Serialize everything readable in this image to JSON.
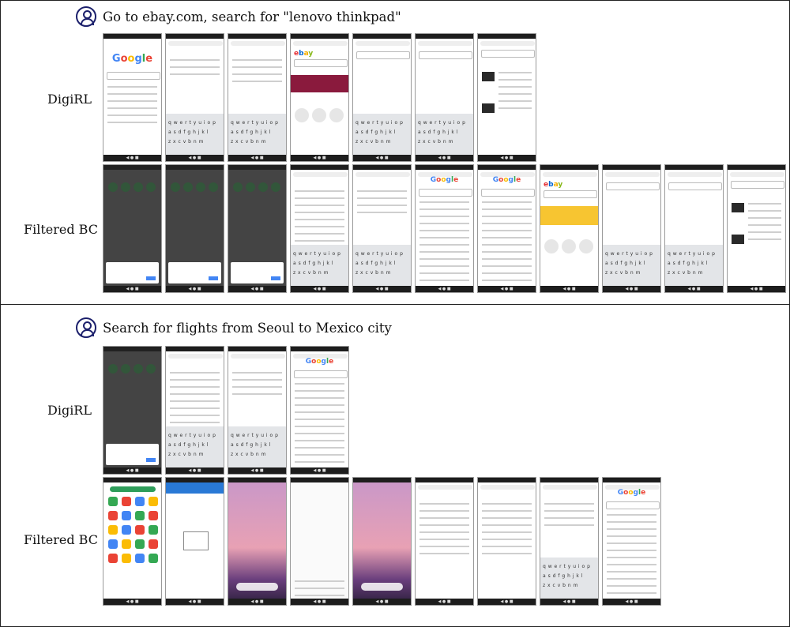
{
  "tasks": [
    {
      "instruction": "Go to ebay.com, search for \"lenovo thinkpad\"",
      "rows": [
        {
          "label": "DigiRL",
          "screens": [
            "google-home",
            "search-suggestions",
            "search-suggestions-typing",
            "ebay-home-promo",
            "ebay-search-keyboard",
            "ebay-search-typed",
            "ebay-results"
          ]
        },
        {
          "label": "Filtered BC",
          "screens": [
            "dark-signin",
            "dark-signin",
            "dark-signin",
            "search-history",
            "search-suggestions-typing",
            "google-results-ebay",
            "google-results-ebay",
            "ebay-home-yellow",
            "ebay-search-keyboard",
            "ebay-search-typed",
            "ebay-results"
          ]
        }
      ]
    },
    {
      "instruction": "Search for flights from Seoul to Mexico city",
      "rows": [
        {
          "label": "DigiRL",
          "screens": [
            "dark-signin",
            "search-history",
            "search-suggestions-typing",
            "google-flight-results"
          ]
        },
        {
          "label": "Filtered BC",
          "screens": [
            "app-drawer",
            "downloads",
            "wallpaper-home",
            "blank-notice",
            "wallpaper-home",
            "trending-searches",
            "trending-searches",
            "search-suggestions-typing",
            "google-flight-results"
          ]
        }
      ]
    }
  ],
  "colors": {
    "border": "#222222",
    "icon": "#1b1f6b",
    "google_blue": "#4285f4",
    "ebay_red": "#e53238"
  }
}
